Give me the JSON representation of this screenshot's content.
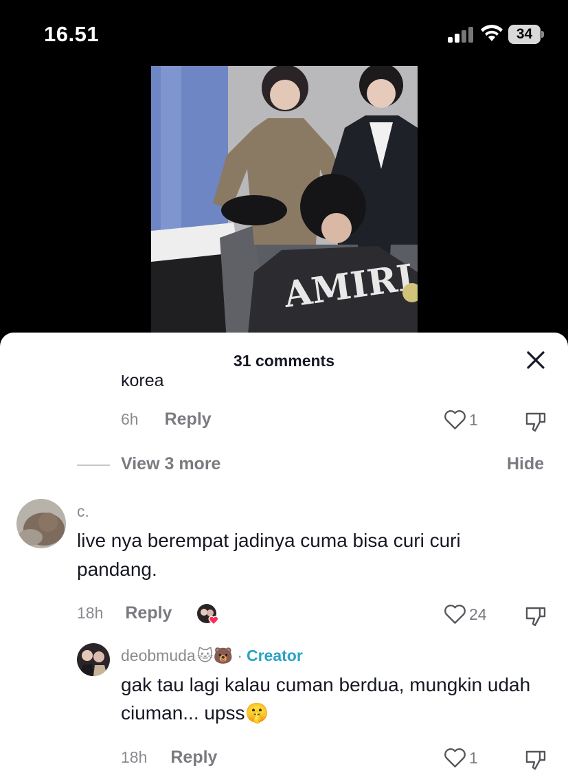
{
  "status_bar": {
    "time": "16.51",
    "battery": "34"
  },
  "sheet": {
    "title": "31 comments"
  },
  "prev_reply": {
    "text_tail": "korea",
    "time": "6h",
    "reply_label": "Reply",
    "likes": "1"
  },
  "view_more": {
    "label": "View 3 more",
    "hide_label": "Hide"
  },
  "comment": {
    "username": "c.",
    "text": "live nya berempat jadinya cuma bisa curi curi pandang.",
    "time": "18h",
    "reply_label": "Reply",
    "likes": "24"
  },
  "creator_reply": {
    "username": "deobmuda",
    "emojis": "🐱🐻",
    "separator": "·",
    "creator_label": "Creator",
    "text": "gak tau lagi kalau cuman berdua, mungkin udah ciuman... upss🤫",
    "time": "18h",
    "reply_label": "Reply",
    "likes": "1"
  },
  "icons": {
    "close": "close-icon",
    "like": "heart-outline-icon",
    "dislike": "thumbs-down-icon"
  },
  "colors": {
    "creator": "#2aa3c7",
    "text": "#161823",
    "muted": "#8a8b91",
    "liked_heart": "#fe2c55"
  }
}
